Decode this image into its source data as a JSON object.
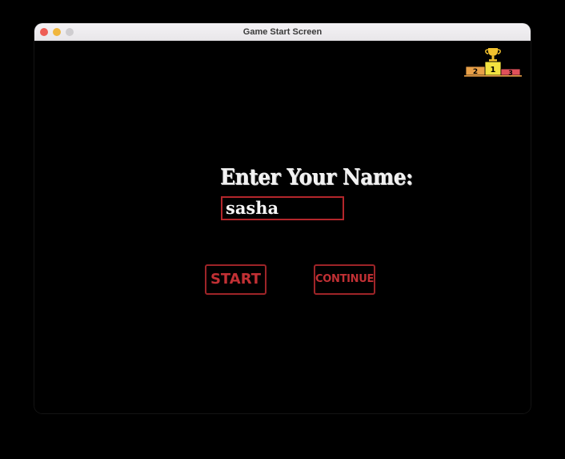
{
  "window": {
    "title": "Game Start Screen",
    "traffic_lights": {
      "close_color": "#ee5d55",
      "minimize_color": "#f0b63e",
      "zoom_color": "#cfcdd0"
    }
  },
  "game": {
    "leaderboard_icon": "podium-trophy-icon",
    "podium_labels": [
      "1",
      "2",
      "3"
    ],
    "name_prompt": "Enter Your Name:",
    "name_value": "sasha",
    "start_label": "START",
    "continue_label": "CONTINUE",
    "colors": {
      "background": "#000000",
      "accent_red": "#b3262b",
      "text_white": "#f2f2f2",
      "podium_gold": "#f2c12e",
      "podium_orange": "#e8a048",
      "podium_red": "#e0505a"
    }
  }
}
